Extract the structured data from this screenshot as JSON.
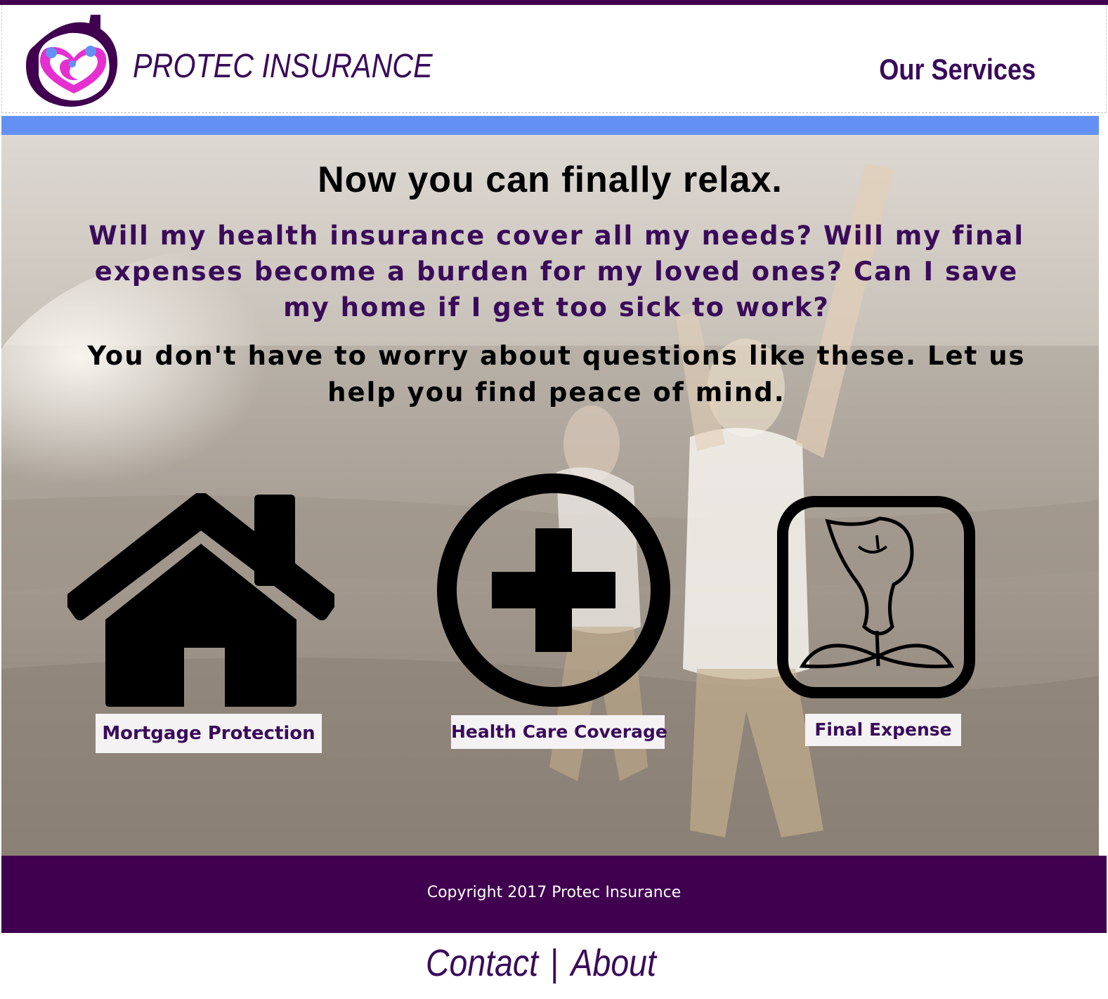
{
  "header": {
    "brand": "PROTEC INSURANCE",
    "services_link": "Our Services",
    "logo_icon": "heart-house-logo-icon"
  },
  "hero": {
    "headline": "Now you can finally relax.",
    "questions": "Will my health insurance cover all my needs? Will my final expenses become a burden for my loved ones? Can I save my home if I get too sick to work?",
    "reassurance": "You don't have to worry about questions like these. Let us help you find peace of mind."
  },
  "services": [
    {
      "label": "Mortgage Protection",
      "icon": "house-icon"
    },
    {
      "label": "Health Care Coverage",
      "icon": "plus-circle-icon"
    },
    {
      "label": "Final Expense",
      "icon": "lily-flower-icon"
    }
  ],
  "footer": {
    "copyright": "Copyright 2017 Protec Insurance"
  },
  "bottom_nav": {
    "contact": "Contact",
    "separator": "|",
    "about": "About"
  },
  "colors": {
    "brand_purple": "#40004f",
    "text_purple": "#3a0b5a",
    "accent_blue": "#6391f3",
    "logo_pink": "#e62fd0"
  }
}
